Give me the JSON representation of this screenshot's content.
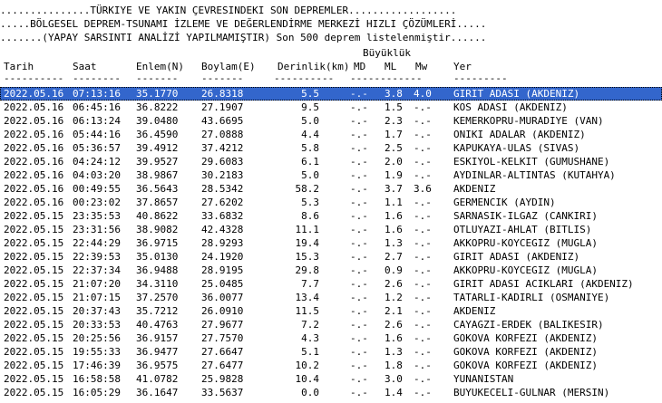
{
  "header": {
    "line1": "...............TÜRKIYE VE YAKIN ÇEVRESINDEKI SON DEPREMLER..................",
    "line2": ".....BÖLGESEL DEPREM-TSUNAMI İZLEME VE DEĞERLENDİRME MERKEZİ HIZLI ÇÖZÜMLERİ.....",
    "line3": ".......(YAPAY SARSINTI ANALİZİ YAPILMAMIŞTIR) Son 500 deprem listelenmiştir......"
  },
  "columns": {
    "magnitude_group": "Büyüklük",
    "date": "Tarih",
    "time": "Saat",
    "lat": "Enlem(N)",
    "lon": "Boylam(E)",
    "depth": "Derinlik(km)",
    "md": "MD",
    "ml": "ML",
    "mw": "Mw",
    "location": "Yer"
  },
  "separators": {
    "date": "----------",
    "time": "--------",
    "lat": "-------",
    "lon": "-------",
    "depth": "----------",
    "mag": "------------",
    "location": "---------"
  },
  "rows": [
    {
      "date": "2022.05.16",
      "time": "07:13:16",
      "lat": "35.1770",
      "lon": "26.8318",
      "depth": "5.5",
      "md": "-.-",
      "ml": "3.8",
      "mw": "4.0",
      "location": "GIRIT ADASI (AKDENIZ)"
    },
    {
      "date": "2022.05.16",
      "time": "06:45:16",
      "lat": "36.8222",
      "lon": "27.1907",
      "depth": "9.5",
      "md": "-.-",
      "ml": "1.5",
      "mw": "-.-",
      "location": "KOS ADASI (AKDENIZ)"
    },
    {
      "date": "2022.05.16",
      "time": "06:13:24",
      "lat": "39.0480",
      "lon": "43.6695",
      "depth": "5.0",
      "md": "-.-",
      "ml": "2.3",
      "mw": "-.-",
      "location": "KEMERKOPRU-MURADIYE (VAN)"
    },
    {
      "date": "2022.05.16",
      "time": "05:44:16",
      "lat": "36.4590",
      "lon": "27.0888",
      "depth": "4.4",
      "md": "-.-",
      "ml": "1.7",
      "mw": "-.-",
      "location": "ONIKI ADALAR (AKDENIZ)"
    },
    {
      "date": "2022.05.16",
      "time": "05:36:57",
      "lat": "39.4912",
      "lon": "37.4212",
      "depth": "5.8",
      "md": "-.-",
      "ml": "2.5",
      "mw": "-.-",
      "location": "KAPUKAYA-ULAS (SIVAS)"
    },
    {
      "date": "2022.05.16",
      "time": "04:24:12",
      "lat": "39.9527",
      "lon": "29.6083",
      "depth": "6.1",
      "md": "-.-",
      "ml": "2.0",
      "mw": "-.-",
      "location": "ESKIYOL-KELKIT (GUMUSHANE)"
    },
    {
      "date": "2022.05.16",
      "time": "04:03:20",
      "lat": "38.9867",
      "lon": "30.2183",
      "depth": "5.0",
      "md": "-.-",
      "ml": "1.9",
      "mw": "-.-",
      "location": "AYDINLAR-ALTINTAS (KUTAHYA)"
    },
    {
      "date": "2022.05.16",
      "time": "00:49:55",
      "lat": "36.5643",
      "lon": "28.5342",
      "depth": "58.2",
      "md": "-.-",
      "ml": "3.7",
      "mw": "3.6",
      "location": "AKDENIZ"
    },
    {
      "date": "2022.05.16",
      "time": "00:23:02",
      "lat": "37.8657",
      "lon": "27.6202",
      "depth": "5.3",
      "md": "-.-",
      "ml": "1.1",
      "mw": "-.-",
      "location": "GERMENCIK (AYDIN)"
    },
    {
      "date": "2022.05.15",
      "time": "23:35:53",
      "lat": "40.8622",
      "lon": "33.6832",
      "depth": "8.6",
      "md": "-.-",
      "ml": "1.6",
      "mw": "-.-",
      "location": "SARNASIK-ILGAZ (CANKIRI)"
    },
    {
      "date": "2022.05.15",
      "time": "23:31:56",
      "lat": "38.9082",
      "lon": "42.4328",
      "depth": "11.1",
      "md": "-.-",
      "ml": "1.6",
      "mw": "-.-",
      "location": "OTLUYAZI-AHLAT (BITLIS)"
    },
    {
      "date": "2022.05.15",
      "time": "22:44:29",
      "lat": "36.9715",
      "lon": "28.9293",
      "depth": "19.4",
      "md": "-.-",
      "ml": "1.3",
      "mw": "-.-",
      "location": "AKKOPRU-KOYCEGIZ (MUGLA)"
    },
    {
      "date": "2022.05.15",
      "time": "22:39:53",
      "lat": "35.0130",
      "lon": "24.1920",
      "depth": "15.3",
      "md": "-.-",
      "ml": "2.7",
      "mw": "-.-",
      "location": "GIRIT ADASI (AKDENIZ)"
    },
    {
      "date": "2022.05.15",
      "time": "22:37:34",
      "lat": "36.9488",
      "lon": "28.9195",
      "depth": "29.8",
      "md": "-.-",
      "ml": "0.9",
      "mw": "-.-",
      "location": "AKKOPRU-KOYCEGIZ (MUGLA)"
    },
    {
      "date": "2022.05.15",
      "time": "21:07:20",
      "lat": "34.3110",
      "lon": "25.0485",
      "depth": "7.7",
      "md": "-.-",
      "ml": "2.6",
      "mw": "-.-",
      "location": "GIRIT ADASI ACIKLARI (AKDENIZ)"
    },
    {
      "date": "2022.05.15",
      "time": "21:07:15",
      "lat": "37.2570",
      "lon": "36.0077",
      "depth": "13.4",
      "md": "-.-",
      "ml": "1.2",
      "mw": "-.-",
      "location": "TATARLI-KADIRLI (OSMANIYE)"
    },
    {
      "date": "2022.05.15",
      "time": "20:37:43",
      "lat": "35.7212",
      "lon": "26.0910",
      "depth": "11.5",
      "md": "-.-",
      "ml": "2.1",
      "mw": "-.-",
      "location": "AKDENIZ"
    },
    {
      "date": "2022.05.15",
      "time": "20:33:53",
      "lat": "40.4763",
      "lon": "27.9677",
      "depth": "7.2",
      "md": "-.-",
      "ml": "2.6",
      "mw": "-.-",
      "location": "CAYAGZI-ERDEK (BALIKESIR)"
    },
    {
      "date": "2022.05.15",
      "time": "20:25:56",
      "lat": "36.9157",
      "lon": "27.7570",
      "depth": "4.3",
      "md": "-.-",
      "ml": "1.6",
      "mw": "-.-",
      "location": "GOKOVA KORFEZI (AKDENIZ)"
    },
    {
      "date": "2022.05.15",
      "time": "19:55:33",
      "lat": "36.9477",
      "lon": "27.6647",
      "depth": "5.1",
      "md": "-.-",
      "ml": "1.3",
      "mw": "-.-",
      "location": "GOKOVA KORFEZI (AKDENIZ)"
    },
    {
      "date": "2022.05.15",
      "time": "17:46:39",
      "lat": "36.9575",
      "lon": "27.6477",
      "depth": "10.2",
      "md": "-.-",
      "ml": "1.8",
      "mw": "-.-",
      "location": "GOKOVA KORFEZI (AKDENIZ)"
    },
    {
      "date": "2022.05.15",
      "time": "16:58:58",
      "lat": "41.0782",
      "lon": "25.9828",
      "depth": "10.4",
      "md": "-.-",
      "ml": "3.0",
      "mw": "-.-",
      "location": "YUNANISTAN"
    },
    {
      "date": "2022.05.15",
      "time": "16:05:29",
      "lat": "36.1647",
      "lon": "33.5637",
      "depth": "0.0",
      "md": "-.-",
      "ml": "1.4",
      "mw": "-.-",
      "location": "BUYUKECELI-GULNAR (MERSIN)"
    }
  ]
}
